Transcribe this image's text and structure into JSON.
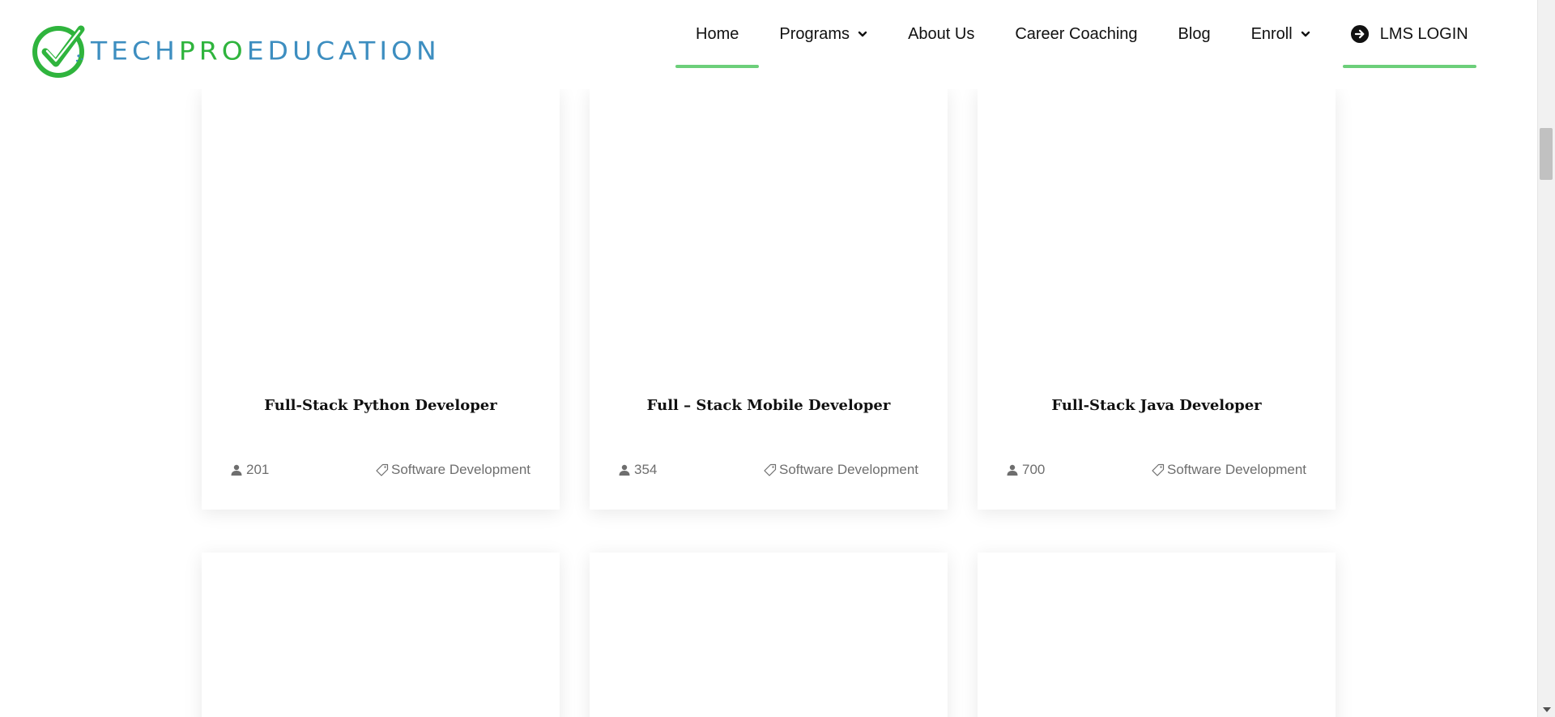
{
  "logo": {
    "text_part1": "TECH",
    "text_part2": "PRO",
    "text_part3": "EDUCATION",
    "colors": {
      "blue": "#3d8ec0",
      "green": "#2fb43d"
    }
  },
  "nav": {
    "home": "Home",
    "programs": "Programs",
    "about": "About Us",
    "career": "Career Coaching",
    "blog": "Blog",
    "enroll": "Enroll",
    "lms_login": "LMS LOGIN",
    "accent_color": "#6ccf7a"
  },
  "courses": [
    {
      "title": "Full-Stack Python Developer",
      "students": "201",
      "category": "Software Development"
    },
    {
      "title": "Full – Stack Mobile Developer",
      "students": "354",
      "category": "Software Development"
    },
    {
      "title": "Full-Stack Java Developer",
      "students": "700",
      "category": "Software Development"
    }
  ],
  "icons": {
    "students": "user-icon",
    "category": "tag-icon",
    "login": "arrow-circle-right-icon",
    "dropdown": "chevron-down-icon"
  }
}
